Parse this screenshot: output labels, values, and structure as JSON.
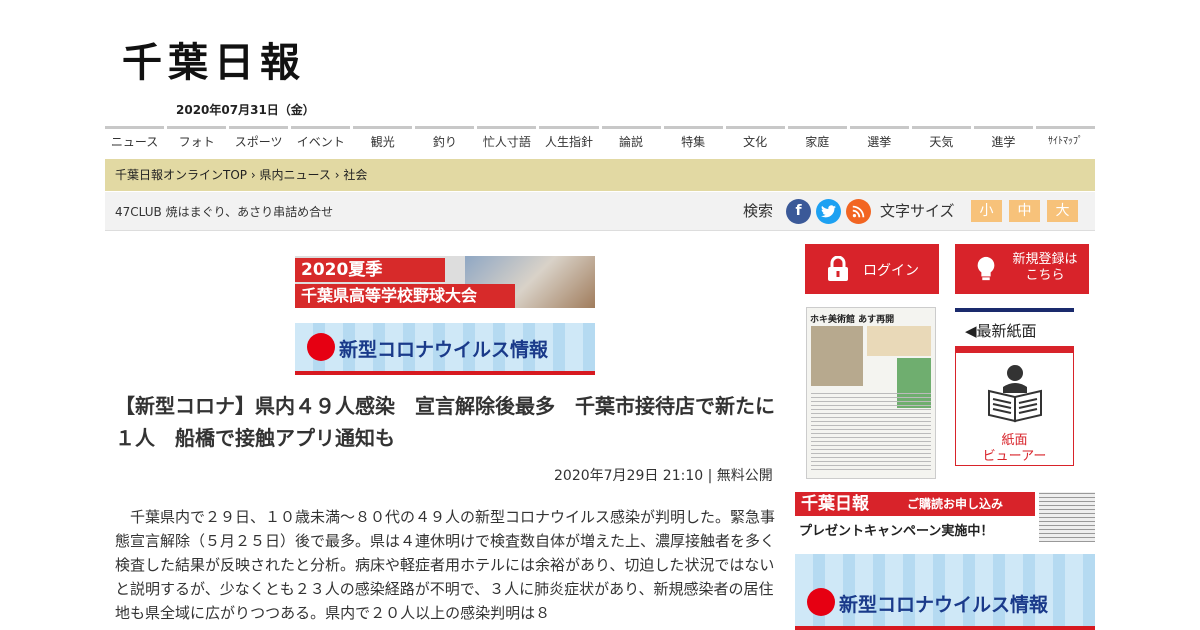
{
  "site": {
    "logo_text": "千葉日報",
    "date": "2020年07月31日（金）"
  },
  "nav": {
    "items": [
      "ニュース",
      "フォト",
      "スポーツ",
      "イベント",
      "観光",
      "釣り",
      "忙人寸語",
      "人生指針",
      "論説",
      "特集",
      "文化",
      "家庭",
      "選挙",
      "天気",
      "進学",
      "ｻｲﾄﾏｯﾌﾟ"
    ]
  },
  "breadcrumb": {
    "items": [
      "千葉日報オンラインTOP",
      "県内ニュース",
      "社会"
    ],
    "separator": "›"
  },
  "toolbar": {
    "ticker": "47CLUB 焼はまぐり、あさり串詰め合せ",
    "search_label": "検索",
    "social": [
      "facebook-icon",
      "twitter-icon",
      "rss-icon"
    ],
    "font_size_label": "文字サイズ",
    "font_sizes": [
      "小",
      "中",
      "大"
    ],
    "font_size_color": "#f7c27a"
  },
  "banners": {
    "highschool_line1": "2020夏季",
    "highschool_line2": "千葉県高等学校野球大会",
    "corona": "新型コロナウイルス情報"
  },
  "article": {
    "headline": "【新型コロナ】県内４９人感染　宣言解除後最多　千葉市接待店で新たに１人　船橋で接触アプリ通知も",
    "meta": "2020年7月29日 21:10 | 無料公開",
    "body": "千葉県内で２９日、１０歳未満～８０代の４９人の新型コロナウイルス感染が判明した。緊急事態宣言解除（５月２５日）後で最多。県は４連休明けで検査数自体が増えた上、濃厚接触者を多く検査した結果が反映されたと分析。病床や軽症者用ホテルには余裕があり、切迫した状況ではないと説明するが、少なくとも２３人の感染経路が不明で、３人に肺炎症状があり、新規感染者の居住地も県全域に広がりつつある。県内で２０人以上の感染判明は８"
  },
  "sidebar": {
    "login_label": "ログイン",
    "register_label": "新規登録は\nこちら",
    "paper_headline": "ホキ美術館 あす再開",
    "latest_title": "◀最新紙面",
    "viewer_label": "紙面\nビューアー",
    "subscribe_title": "千葉日報",
    "subscribe_sub": "ご購読お申し込み",
    "subscribe_campaign": "プレゼントキャンペーン実施中！",
    "accent_color": "#d8232a"
  }
}
